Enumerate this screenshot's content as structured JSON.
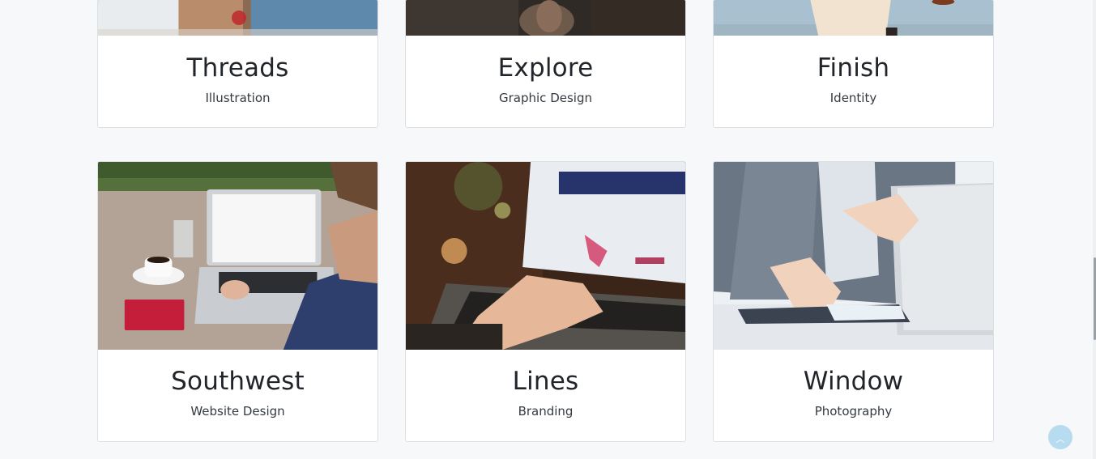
{
  "portfolio": {
    "items": [
      {
        "title": "Threads",
        "category": "Illustration",
        "image": "laptop-meeting-photo"
      },
      {
        "title": "Explore",
        "category": "Graphic Design",
        "image": "dark-landscape-photo"
      },
      {
        "title": "Finish",
        "category": "Identity",
        "image": "person-outdoor-photo"
      },
      {
        "title": "Southwest",
        "category": "Website Design",
        "image": "man-laptop-coffee-photo"
      },
      {
        "title": "Lines",
        "category": "Branding",
        "image": "hands-typing-laptop-photo"
      },
      {
        "title": "Window",
        "category": "Photography",
        "image": "businessman-laptop-photo"
      }
    ]
  },
  "scroll_top": {
    "icon": "chevron-up-icon"
  },
  "colors": {
    "background": "#f7f8fa",
    "card": "#ffffff",
    "scroll_button": "#b7dbef"
  }
}
